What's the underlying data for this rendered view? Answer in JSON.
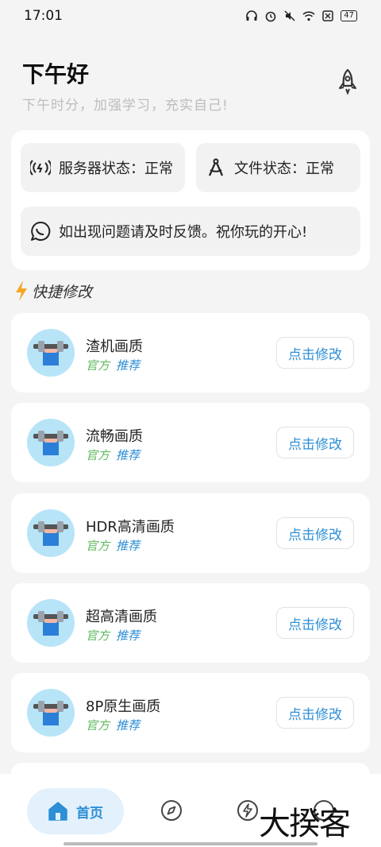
{
  "status_bar": {
    "time": "17:01",
    "battery": "47"
  },
  "header": {
    "greeting": "下午好",
    "subtitle": "下午时分，加强学习，充实自己!"
  },
  "info": {
    "server_status": "服务器状态：正常",
    "file_status": "文件状态：正常",
    "feedback": "如出现问题请及时反馈。祝你玩的开心!"
  },
  "section": {
    "title": "快捷修改"
  },
  "items": [
    {
      "name": "渣机画质",
      "tag_official": "官方",
      "tag_recommend": "推荐",
      "button": "点击修改"
    },
    {
      "name": "流畅画质",
      "tag_official": "官方",
      "tag_recommend": "推荐",
      "button": "点击修改"
    },
    {
      "name": "HDR高清画质",
      "tag_official": "官方",
      "tag_recommend": "推荐",
      "button": "点击修改"
    },
    {
      "name": "超高清画质",
      "tag_official": "官方",
      "tag_recommend": "推荐",
      "button": "点击修改"
    },
    {
      "name": "8P原生画质",
      "tag_official": "官方",
      "tag_recommend": "推荐",
      "button": "点击修改"
    }
  ],
  "nav": {
    "home_label": "首页"
  },
  "watermark": "大揆客",
  "colors": {
    "accent": "#2d8fd5",
    "official_tag": "#5cb85c",
    "background": "#f4f4f4"
  },
  "icons": [
    "rocket-icon",
    "broadcast-icon",
    "compass-drafting-icon",
    "chat-icon",
    "lightning-icon",
    "tool-icon",
    "home-icon",
    "compass-icon",
    "bolt-circle-icon"
  ]
}
